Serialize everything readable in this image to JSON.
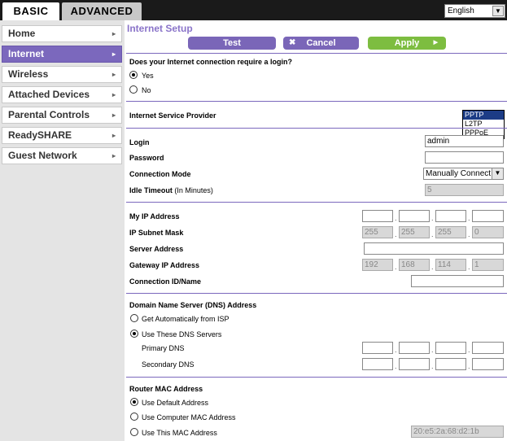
{
  "top": {
    "tabs": [
      "BASIC",
      "ADVANCED"
    ],
    "language": "English"
  },
  "sidebar": {
    "items": [
      {
        "label": "Home"
      },
      {
        "label": "Internet"
      },
      {
        "label": "Wireless"
      },
      {
        "label": "Attached Devices"
      },
      {
        "label": "Parental Controls"
      },
      {
        "label": "ReadySHARE"
      },
      {
        "label": "Guest Network"
      }
    ]
  },
  "page": {
    "title": "Internet Setup",
    "buttons": {
      "test": "Test",
      "cancel": "Cancel",
      "apply": "Apply"
    },
    "login_question": "Does your Internet connection require a login?",
    "yes": "Yes",
    "no": "No",
    "isp_label": "Internet Service Provider",
    "isp_options": [
      "PPTP",
      "L2TP",
      "PPPoE"
    ],
    "isp_selected": "PPTP",
    "login_label": "Login",
    "login_value": "admin",
    "password_label": "Password",
    "conn_mode_label": "Connection Mode",
    "conn_mode_value": "Manually Connect",
    "idle_label": "Idle Timeout",
    "idle_suffix": "(In Minutes)",
    "idle_value": "5",
    "my_ip_label": "My IP Address",
    "subnet_label": "IP Subnet Mask",
    "subnet": [
      "255",
      "255",
      "255",
      "0"
    ],
    "server_label": "Server Address",
    "gateway_label": "Gateway IP Address",
    "gateway": [
      "192",
      "168",
      "114",
      "1"
    ],
    "connid_label": "Connection ID/Name",
    "dns_title": "Domain Name Server (DNS) Address",
    "dns_auto": "Get Automatically from ISP",
    "dns_manual": "Use These DNS Servers",
    "primary_dns": "Primary DNS",
    "secondary_dns": "Secondary DNS",
    "mac_title": "Router MAC Address",
    "mac_default": "Use Default Address",
    "mac_computer": "Use Computer MAC Address",
    "mac_this": "Use This MAC Address",
    "mac_value": "20:e5:2a:68:d2:1b"
  },
  "colors": {
    "accent": "#7b68bd",
    "apply": "#7dbd40",
    "topbar": "#1a1a1a"
  }
}
